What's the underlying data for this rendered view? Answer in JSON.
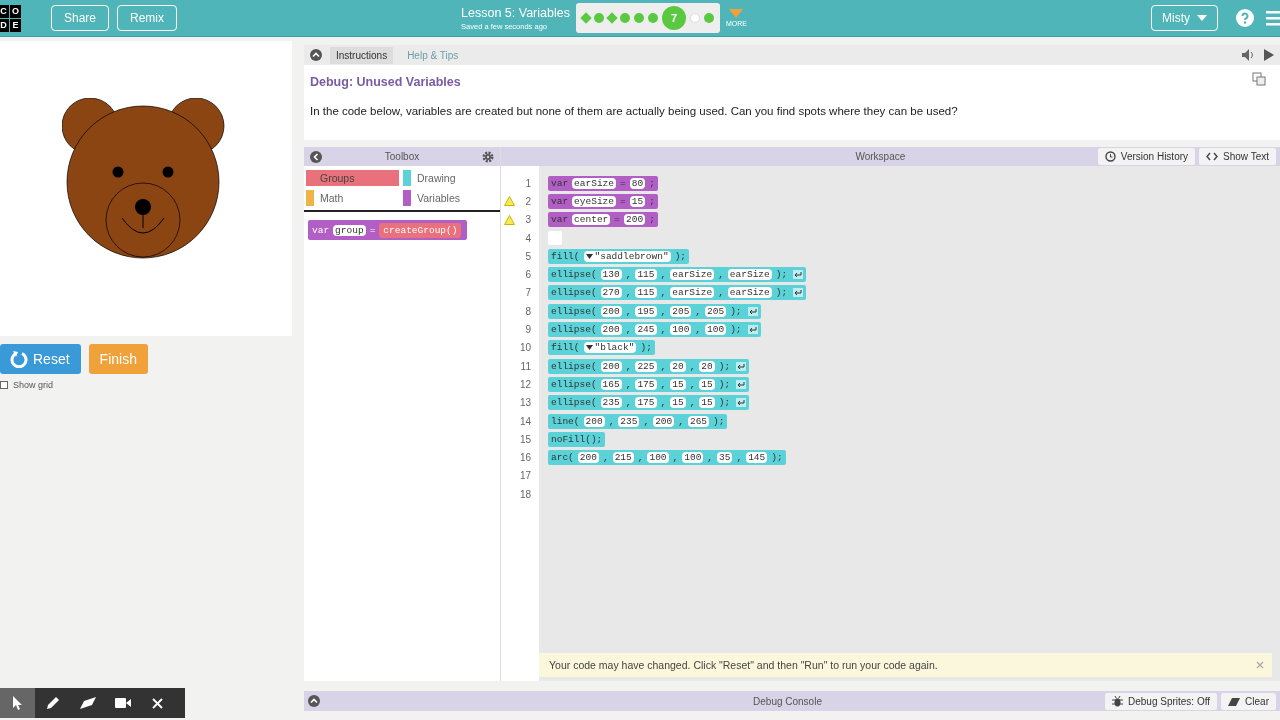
{
  "header": {
    "logo_letters": [
      "C",
      "O",
      "D",
      "E"
    ],
    "buttons": [
      "Share",
      "Remix"
    ],
    "lesson_title": "Lesson 5: Variables",
    "save_status": "Saved a few seconds ago",
    "progress": [
      {
        "kind": "diamond",
        "done": true
      },
      {
        "kind": "dot",
        "done": true
      },
      {
        "kind": "diamond",
        "done": true
      },
      {
        "kind": "dot",
        "done": true
      },
      {
        "kind": "dot",
        "done": true
      },
      {
        "kind": "dot",
        "done": true
      },
      {
        "kind": "current",
        "done": true,
        "label": "7"
      },
      {
        "kind": "dot",
        "done": false
      },
      {
        "kind": "dot",
        "done": true
      }
    ],
    "more_label": "MORE",
    "user_menu": "Misty"
  },
  "stage": {
    "buttons": [
      {
        "kind": "reset",
        "label": "Reset"
      },
      {
        "kind": "finish",
        "label": "Finish"
      }
    ],
    "show_grid": {
      "label": "Show grid",
      "checked": false
    }
  },
  "instructions": {
    "tabs": [
      {
        "label": "Instructions",
        "selected": true
      },
      {
        "label": "Help & Tips",
        "selected": false
      }
    ],
    "title": "Debug: Unused Variables",
    "text": "In the code below, variables are created but none of them are actually being used. Can you find spots where they can be used?"
  },
  "toolbox": {
    "title": "Toolbox",
    "categories": [
      {
        "label": "Groups",
        "color": "#e8717b",
        "selected": true
      },
      {
        "label": "Drawing",
        "color": "#5bd2d8",
        "selected": false
      },
      {
        "label": "Math",
        "color": "#f0b347",
        "selected": false
      },
      {
        "label": "Variables",
        "color": "#b15fc4",
        "selected": false
      }
    ],
    "block": [
      {
        "kind": "text",
        "text": "var"
      },
      {
        "kind": "slot",
        "text": "group"
      },
      {
        "kind": "text",
        "text": "="
      },
      {
        "kind": "call",
        "text": "createGroup()"
      }
    ]
  },
  "workspace": {
    "title": "Workspace",
    "buttons": [
      {
        "kind": "history",
        "label": "Version History"
      },
      {
        "kind": "code",
        "label": "Show Text"
      }
    ],
    "lines": [
      {
        "number": "1",
        "kind": "variable",
        "warning": false,
        "return_icon": false,
        "parts": [
          {
            "kind": "text",
            "text": "var"
          },
          {
            "kind": "slot",
            "text": "earSize"
          },
          {
            "kind": "text",
            "text": "="
          },
          {
            "kind": "slot",
            "text": "80"
          },
          {
            "kind": "text",
            "text": ";"
          }
        ]
      },
      {
        "number": "2",
        "kind": "variable",
        "warning": true,
        "return_icon": false,
        "parts": [
          {
            "kind": "text",
            "text": "var"
          },
          {
            "kind": "slot",
            "text": "eyeSize"
          },
          {
            "kind": "text",
            "text": "="
          },
          {
            "kind": "slot",
            "text": "15"
          },
          {
            "kind": "text",
            "text": ";"
          }
        ]
      },
      {
        "number": "3",
        "kind": "variable",
        "warning": true,
        "return_icon": false,
        "parts": [
          {
            "kind": "text",
            "text": "var"
          },
          {
            "kind": "slot",
            "text": "center"
          },
          {
            "kind": "text",
            "text": "="
          },
          {
            "kind": "slot",
            "text": "200"
          },
          {
            "kind": "text",
            "text": ";"
          }
        ]
      },
      {
        "number": "4",
        "kind": "empty",
        "warning": false
      },
      {
        "number": "5",
        "kind": "drawing",
        "warning": false,
        "return_icon": false,
        "parts": [
          {
            "kind": "text",
            "text": "fill("
          },
          {
            "kind": "dropdown",
            "text": "\"saddlebrown\""
          },
          {
            "kind": "text",
            "text": ");"
          }
        ]
      },
      {
        "number": "6",
        "kind": "drawing",
        "warning": false,
        "return_icon": true,
        "parts": [
          {
            "kind": "text",
            "text": "ellipse("
          },
          {
            "kind": "slot",
            "text": "130"
          },
          {
            "kind": "text",
            "text": ","
          },
          {
            "kind": "slot",
            "text": "115"
          },
          {
            "kind": "text",
            "text": ","
          },
          {
            "kind": "slot",
            "text": "earSize"
          },
          {
            "kind": "text",
            "text": ","
          },
          {
            "kind": "slot",
            "text": "earSize"
          },
          {
            "kind": "text",
            "text": ");"
          }
        ]
      },
      {
        "number": "7",
        "kind": "drawing",
        "warning": false,
        "return_icon": true,
        "parts": [
          {
            "kind": "text",
            "text": "ellipse("
          },
          {
            "kind": "slot",
            "text": "270"
          },
          {
            "kind": "text",
            "text": ","
          },
          {
            "kind": "slot",
            "text": "115"
          },
          {
            "kind": "text",
            "text": ","
          },
          {
            "kind": "slot",
            "text": "earSize"
          },
          {
            "kind": "text",
            "text": ","
          },
          {
            "kind": "slot",
            "text": "earSize"
          },
          {
            "kind": "text",
            "text": ");"
          }
        ]
      },
      {
        "number": "8",
        "kind": "drawing",
        "warning": false,
        "return_icon": true,
        "parts": [
          {
            "kind": "text",
            "text": "ellipse("
          },
          {
            "kind": "slot",
            "text": "200"
          },
          {
            "kind": "text",
            "text": ","
          },
          {
            "kind": "slot",
            "text": "195"
          },
          {
            "kind": "text",
            "text": ","
          },
          {
            "kind": "slot",
            "text": "205"
          },
          {
            "kind": "text",
            "text": ","
          },
          {
            "kind": "slot",
            "text": "205"
          },
          {
            "kind": "text",
            "text": ");"
          }
        ]
      },
      {
        "number": "9",
        "kind": "drawing",
        "warning": false,
        "return_icon": true,
        "parts": [
          {
            "kind": "text",
            "text": "ellipse("
          },
          {
            "kind": "slot",
            "text": "200"
          },
          {
            "kind": "text",
            "text": ","
          },
          {
            "kind": "slot",
            "text": "245"
          },
          {
            "kind": "text",
            "text": ","
          },
          {
            "kind": "slot",
            "text": "100"
          },
          {
            "kind": "text",
            "text": ","
          },
          {
            "kind": "slot",
            "text": "100"
          },
          {
            "kind": "text",
            "text": ");"
          }
        ]
      },
      {
        "number": "10",
        "kind": "drawing",
        "warning": false,
        "return_icon": false,
        "parts": [
          {
            "kind": "text",
            "text": "fill("
          },
          {
            "kind": "dropdown",
            "text": "\"black\""
          },
          {
            "kind": "text",
            "text": ");"
          }
        ]
      },
      {
        "number": "11",
        "kind": "drawing",
        "warning": false,
        "return_icon": true,
        "parts": [
          {
            "kind": "text",
            "text": "ellipse("
          },
          {
            "kind": "slot",
            "text": "200"
          },
          {
            "kind": "text",
            "text": ","
          },
          {
            "kind": "slot",
            "text": "225"
          },
          {
            "kind": "text",
            "text": ","
          },
          {
            "kind": "slot",
            "text": "20"
          },
          {
            "kind": "text",
            "text": ","
          },
          {
            "kind": "slot",
            "text": "20"
          },
          {
            "kind": "text",
            "text": ");"
          }
        ]
      },
      {
        "number": "12",
        "kind": "drawing",
        "warning": false,
        "return_icon": true,
        "parts": [
          {
            "kind": "text",
            "text": "ellipse("
          },
          {
            "kind": "slot",
            "text": "165"
          },
          {
            "kind": "text",
            "text": ","
          },
          {
            "kind": "slot",
            "text": "175"
          },
          {
            "kind": "text",
            "text": ","
          },
          {
            "kind": "slot",
            "text": "15"
          },
          {
            "kind": "text",
            "text": ","
          },
          {
            "kind": "slot",
            "text": "15"
          },
          {
            "kind": "text",
            "text": ");"
          }
        ]
      },
      {
        "number": "13",
        "kind": "drawing",
        "warning": false,
        "return_icon": true,
        "parts": [
          {
            "kind": "text",
            "text": "ellipse("
          },
          {
            "kind": "slot",
            "text": "235"
          },
          {
            "kind": "text",
            "text": ","
          },
          {
            "kind": "slot",
            "text": "175"
          },
          {
            "kind": "text",
            "text": ","
          },
          {
            "kind": "slot",
            "text": "15"
          },
          {
            "kind": "text",
            "text": ","
          },
          {
            "kind": "slot",
            "text": "15"
          },
          {
            "kind": "text",
            "text": ");"
          }
        ]
      },
      {
        "number": "14",
        "kind": "drawing",
        "warning": false,
        "return_icon": false,
        "parts": [
          {
            "kind": "text",
            "text": "line("
          },
          {
            "kind": "slot",
            "text": "200"
          },
          {
            "kind": "text",
            "text": ","
          },
          {
            "kind": "slot",
            "text": "235"
          },
          {
            "kind": "text",
            "text": ","
          },
          {
            "kind": "slot",
            "text": "200"
          },
          {
            "kind": "text",
            "text": ","
          },
          {
            "kind": "slot",
            "text": "265"
          },
          {
            "kind": "text",
            "text": ");"
          }
        ]
      },
      {
        "number": "15",
        "kind": "drawing",
        "warning": false,
        "return_icon": false,
        "parts": [
          {
            "kind": "text",
            "text": "noFill();"
          }
        ]
      },
      {
        "number": "16",
        "kind": "drawing",
        "warning": false,
        "return_icon": false,
        "parts": [
          {
            "kind": "text",
            "text": "arc("
          },
          {
            "kind": "slot",
            "text": "200"
          },
          {
            "kind": "text",
            "text": ","
          },
          {
            "kind": "slot",
            "text": "215"
          },
          {
            "kind": "text",
            "text": ","
          },
          {
            "kind": "slot",
            "text": "100"
          },
          {
            "kind": "text",
            "text": ","
          },
          {
            "kind": "slot",
            "text": "100"
          },
          {
            "kind": "text",
            "text": ","
          },
          {
            "kind": "slot",
            "text": "35"
          },
          {
            "kind": "text",
            "text": ","
          },
          {
            "kind": "slot",
            "text": "145"
          },
          {
            "kind": "text",
            "text": ");"
          }
        ]
      },
      {
        "number": "17",
        "kind": "none",
        "warning": false
      },
      {
        "number": "18",
        "kind": "none",
        "warning": false
      }
    ]
  },
  "notice": "Your code may have changed. Click \"Reset\" and then \"Run\" to run your code again.",
  "debug_console": {
    "title": "Debug Console",
    "buttons": [
      {
        "kind": "sprites",
        "label": "Debug Sprites: Off"
      },
      {
        "kind": "clear",
        "label": "Clear"
      }
    ]
  },
  "drawing_tools": [
    {
      "kind": "pointer",
      "selected": true
    },
    {
      "kind": "pencil",
      "selected": false
    },
    {
      "kind": "eraser",
      "selected": false
    },
    {
      "kind": "camera",
      "selected": false
    },
    {
      "kind": "close",
      "selected": false
    }
  ]
}
